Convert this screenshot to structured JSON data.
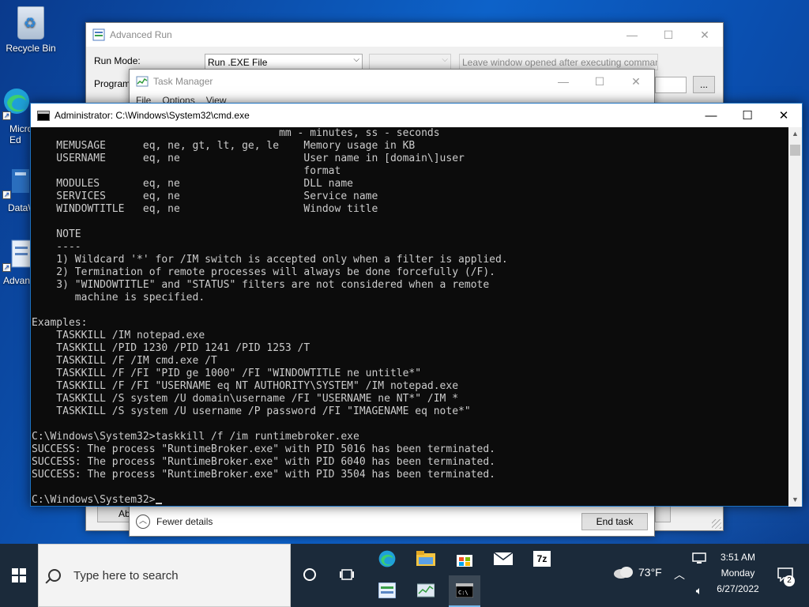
{
  "desktop": {
    "icons": [
      {
        "label": "Recycle Bin"
      },
      {
        "label": "Micro Ed"
      },
      {
        "label": "DataW"
      },
      {
        "label": "Advan"
      }
    ]
  },
  "advanced_run": {
    "title": "Advanced Run",
    "run_mode_label": "Run Mode:",
    "run_mode_value": "Run .EXE File",
    "second_combo_value": "",
    "leave_window_value": "Leave window opened after executing comman",
    "program_label": "Program",
    "browse_label": "...",
    "bottom_button_label": "Ab"
  },
  "task_manager": {
    "title": "Task Manager",
    "menu": [
      "File",
      "Options",
      "View"
    ],
    "fewer_details": "Fewer details",
    "end_task": "End task"
  },
  "cmd": {
    "title": "Administrator: C:\\Windows\\System32\\cmd.exe",
    "lines": [
      "                                        mm - minutes, ss - seconds",
      "    MEMUSAGE      eq, ne, gt, lt, ge, le    Memory usage in KB",
      "    USERNAME      eq, ne                    User name in [domain\\]user",
      "                                            format",
      "    MODULES       eq, ne                    DLL name",
      "    SERVICES      eq, ne                    Service name",
      "    WINDOWTITLE   eq, ne                    Window title",
      "",
      "    NOTE",
      "    ----",
      "    1) Wildcard '*' for /IM switch is accepted only when a filter is applied.",
      "    2) Termination of remote processes will always be done forcefully (/F).",
      "    3) \"WINDOWTITLE\" and \"STATUS\" filters are not considered when a remote",
      "       machine is specified.",
      "",
      "Examples:",
      "    TASKKILL /IM notepad.exe",
      "    TASKKILL /PID 1230 /PID 1241 /PID 1253 /T",
      "    TASKKILL /F /IM cmd.exe /T",
      "    TASKKILL /F /FI \"PID ge 1000\" /FI \"WINDOWTITLE ne untitle*\"",
      "    TASKKILL /F /FI \"USERNAME eq NT AUTHORITY\\SYSTEM\" /IM notepad.exe",
      "    TASKKILL /S system /U domain\\username /FI \"USERNAME ne NT*\" /IM *",
      "    TASKKILL /S system /U username /P password /FI \"IMAGENAME eq note*\"",
      "",
      "C:\\Windows\\System32>taskkill /f /im runtimebroker.exe",
      "SUCCESS: The process \"RuntimeBroker.exe\" with PID 5016 has been terminated.",
      "SUCCESS: The process \"RuntimeBroker.exe\" with PID 6040 has been terminated.",
      "SUCCESS: The process \"RuntimeBroker.exe\" with PID 3504 has been terminated.",
      ""
    ],
    "prompt": "C:\\Windows\\System32>"
  },
  "taskbar": {
    "search_placeholder": "Type here to search",
    "weather": "73°F",
    "time": "3:51 AM",
    "day": "Monday",
    "date": "6/27/2022",
    "notification_count": "2",
    "seven_zip_label": "7z",
    "start_icon": "windows-logo-icon",
    "accent": "#0078d7"
  }
}
